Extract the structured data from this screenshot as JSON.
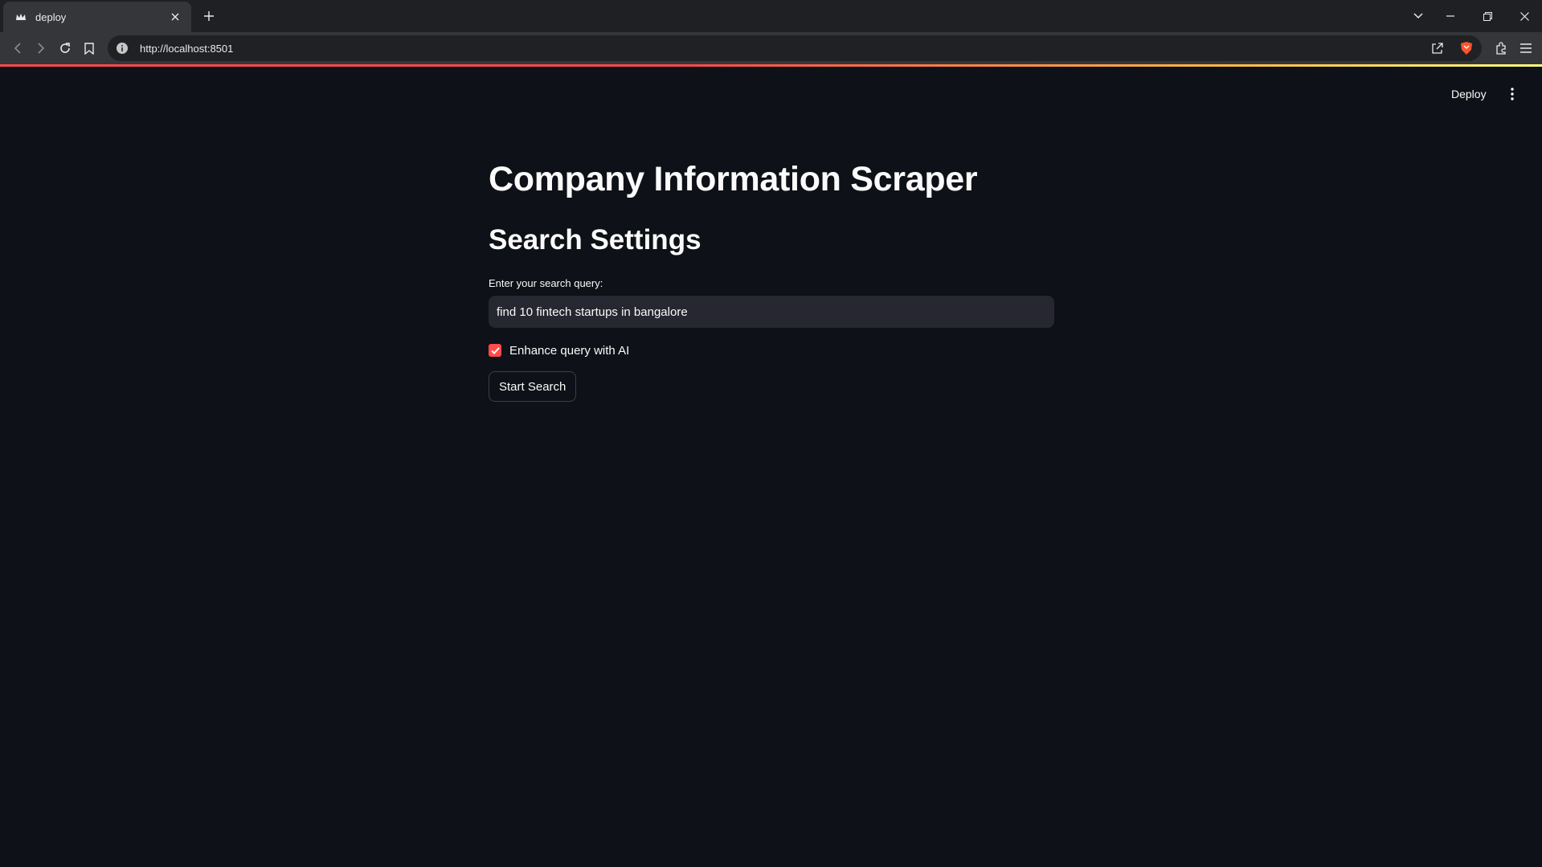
{
  "browser": {
    "tab": {
      "title": "deploy",
      "favicon": "streamlit-crown-icon"
    },
    "address_bar": {
      "url": "http://localhost:8501"
    },
    "toolbar_icons": [
      "back-icon",
      "forward-icon",
      "reload-icon",
      "bookmark-icon",
      "info-icon",
      "share-icon",
      "brave-shield-icon",
      "extensions-icon",
      "menu-icon"
    ],
    "window_controls": [
      "tab-search-icon",
      "minimize-icon",
      "restore-icon",
      "close-icon"
    ]
  },
  "app_header": {
    "deploy_label": "Deploy",
    "menu_icon": "kebab-menu-icon"
  },
  "main": {
    "title": "Company Information Scraper",
    "subheader": "Search Settings",
    "search": {
      "label": "Enter your search query:",
      "value": "find 10 fintech startups in bangalore"
    },
    "enhance_checkbox": {
      "label": "Enhance query with AI",
      "checked": true
    },
    "start_button_label": "Start Search"
  },
  "colors": {
    "background": "#0e1117",
    "accent": "#ff4b4b",
    "input_bg": "#262730"
  }
}
